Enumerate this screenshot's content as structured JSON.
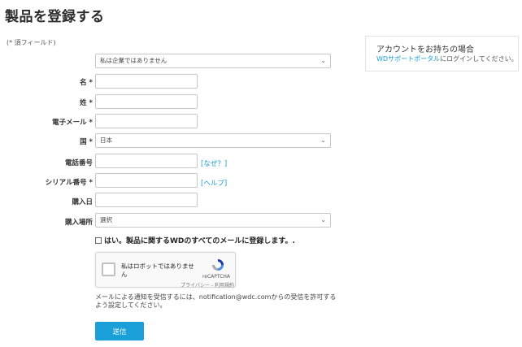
{
  "page": {
    "title": "製品を登録する"
  },
  "form": {
    "required_note": "(* 須フィールド)",
    "account_type": {
      "value": "私は企業ではありません"
    },
    "first_name": {
      "label": "名 *",
      "value": ""
    },
    "last_name": {
      "label": "姓 *",
      "value": ""
    },
    "email": {
      "label": "電子メール *",
      "value": ""
    },
    "country": {
      "label": "国 *",
      "value": "日本"
    },
    "phone": {
      "label": "電話番号",
      "value": "",
      "help": "[なぜ？]"
    },
    "serial": {
      "label": "シリアル番号 *",
      "value": "",
      "help": "[ヘルプ]"
    },
    "purchase_date": {
      "label": "購入日",
      "value": ""
    },
    "purchase_place": {
      "label": "購入場所",
      "value": "選択"
    },
    "optin": {
      "label": "はい。製品に関するWDのすべてのメールに登録します。."
    },
    "captcha": {
      "label": "私はロボットではありません",
      "brand": "reCAPTCHA",
      "terms": "プライバシー - 利用規約"
    },
    "notice": "メールによる通知を受信するには、notification@wdc.comからの受信を許可するよう設定してください。",
    "submit_label": "送信"
  },
  "side": {
    "title": "アカウントをお持ちの場合",
    "link_text": "WDサポートポータル",
    "text": "にログインしてください。"
  },
  "colors": {
    "accent": "#1a9fd8"
  }
}
